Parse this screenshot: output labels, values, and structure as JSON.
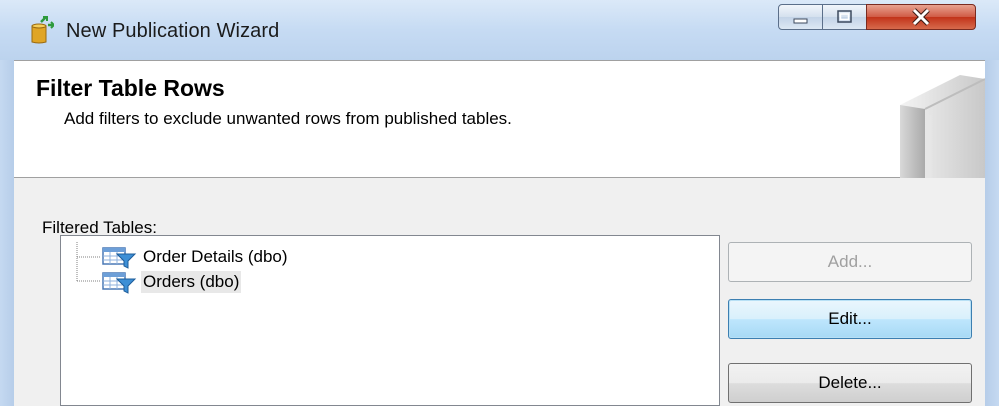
{
  "window": {
    "title": "New Publication Wizard",
    "icon": "publication-wizard-icon",
    "caption_buttons": [
      "minimize",
      "maximize",
      "close"
    ]
  },
  "header": {
    "title": "Filter Table Rows",
    "description": "Add filters to exclude unwanted rows from published tables."
  },
  "filtered_tables": {
    "label": "Filtered Tables:",
    "items": [
      {
        "label": "Order Details (dbo)",
        "icon": "filtered-table-icon",
        "selected": false
      },
      {
        "label": "Orders (dbo)",
        "icon": "filtered-table-icon",
        "selected": true
      }
    ]
  },
  "buttons": {
    "add": {
      "label": "Add...",
      "enabled": false
    },
    "edit": {
      "label": "Edit...",
      "enabled": true,
      "focused": true
    },
    "delete": {
      "label": "Delete...",
      "enabled": true
    }
  },
  "colors": {
    "frame": "#c6dbf3",
    "close_button": "#c2331a",
    "body_background": "#f0f0f0",
    "focus_border": "#3c7fb1"
  }
}
